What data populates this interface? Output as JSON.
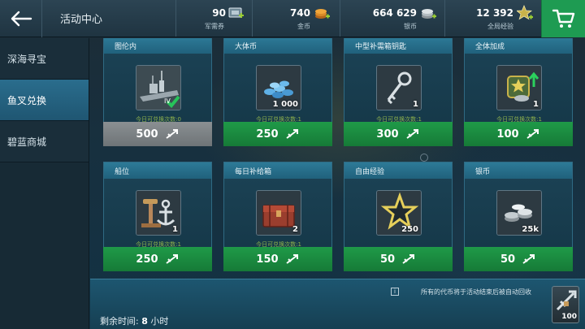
{
  "header": {
    "title": "活动中心",
    "currencies": [
      {
        "value": "90",
        "label": "军需券",
        "icon": "ticket-icon"
      },
      {
        "value": "740",
        "label": "金币",
        "icon": "gold-coin-icon"
      },
      {
        "value": "664 629",
        "label": "银币",
        "icon": "silver-coin-icon"
      },
      {
        "value": "12 392",
        "label": "全局经验",
        "icon": "global-xp-star-icon"
      }
    ]
  },
  "sidebar": {
    "items": [
      {
        "label": "深海寻宝",
        "active": false
      },
      {
        "label": "鱼叉兑换",
        "active": true
      },
      {
        "label": "碧蓝商城",
        "active": false
      }
    ]
  },
  "cards": [
    {
      "name": "图伦内",
      "qty": "",
      "limit": "今日可兑换次数:0",
      "price": "500",
      "disabled": true,
      "icon": "ship-icon"
    },
    {
      "name": "大体币",
      "qty": "1 000",
      "limit": "今日可兑换次数:1",
      "price": "250",
      "disabled": false,
      "icon": "blue-coins-icon"
    },
    {
      "name": "中型补需箱钥匙",
      "qty": "1",
      "limit": "今日可兑换次数:1",
      "price": "300",
      "disabled": false,
      "icon": "key-icon"
    },
    {
      "name": "全体加成",
      "qty": "1",
      "limit": "今日可兑换次数:1",
      "price": "100",
      "disabled": false,
      "icon": "fleet-boost-icon"
    },
    {
      "name": "船位",
      "qty": "1",
      "limit": "今日可兑换次数:1",
      "price": "250",
      "disabled": false,
      "icon": "berth-anchor-icon"
    },
    {
      "name": "每日补给箱",
      "qty": "2",
      "limit": "今日可兑换次数:1",
      "price": "150",
      "disabled": false,
      "icon": "supply-crate-icon"
    },
    {
      "name": "自由经验",
      "qty": "250",
      "limit": "",
      "price": "50",
      "disabled": false,
      "icon": "free-xp-star-icon"
    },
    {
      "name": "银币",
      "qty": "25k",
      "limit": "",
      "price": "50",
      "disabled": false,
      "icon": "silver-coins-icon"
    }
  ],
  "footer": {
    "notice": "所有的代币将于活动结束后被自动回收",
    "remaining_label": "剩余时间:",
    "remaining_value": "8",
    "remaining_unit": "小时",
    "token_qty": "100"
  },
  "colors": {
    "accent_green": "#1e9b52",
    "header_bg": "#2c4453",
    "active_tab": "#2a6d8d"
  }
}
